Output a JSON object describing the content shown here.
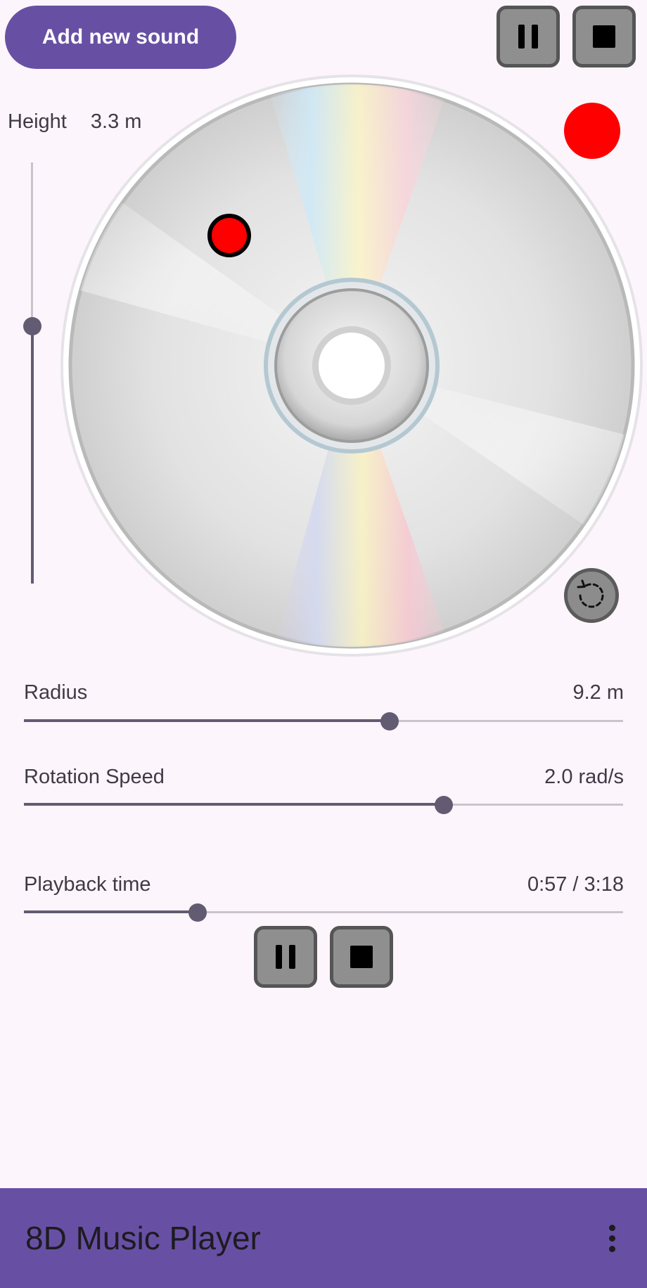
{
  "header": {
    "add_button_label": "Add new sound"
  },
  "height_control": {
    "label": "Height",
    "value": "3.3 m",
    "fraction": 0.61
  },
  "radius_control": {
    "label": "Radius",
    "value": "9.2 m",
    "fraction": 0.612
  },
  "rotation_control": {
    "label": "Rotation Speed",
    "value": "2.0 rad/s",
    "fraction": 0.702
  },
  "playback": {
    "label": "Playback time",
    "value": "0:57 / 3:18",
    "fraction": 0.29
  },
  "app_bar": {
    "title": "8D Music Player"
  },
  "icons": {
    "pause": "pause-icon",
    "stop": "stop-icon",
    "reset": "reset-rotation-icon",
    "menu": "more-vert-icon"
  },
  "colors": {
    "accent": "#6750a4",
    "source_marker": "#ff0000",
    "listener_marker": "#ff0000",
    "slider": "#625b71"
  }
}
